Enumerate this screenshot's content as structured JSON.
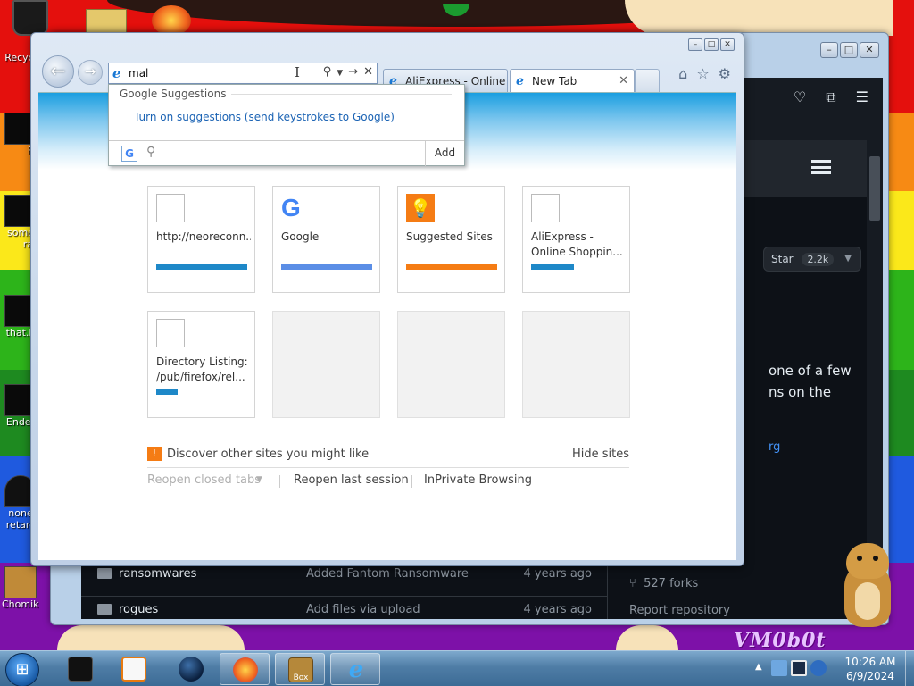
{
  "desktop": {
    "icons": [
      {
        "label": "Recycl"
      },
      {
        "label": "Fir"
      },
      {
        "label": "some"
      },
      {
        "label": "ran"
      },
      {
        "label": "that.b"
      },
      {
        "label": "Ender"
      },
      {
        "label": "none"
      },
      {
        "label": "retarc"
      },
      {
        "label": "ChomikB"
      }
    ],
    "watermark": "VM0b0t"
  },
  "bg_window": {
    "star_label": "Star",
    "star_count": "2.2k",
    "description_line1": "one of a few",
    "description_line2": "ns on the",
    "link_fragment": "rg",
    "files": [
      {
        "name": "ransomwares",
        "message": "Added Fantom Ransomware",
        "time": "4 years ago"
      },
      {
        "name": "rogues",
        "message": "Add files via upload",
        "time": "4 years ago"
      }
    ],
    "forks": "527 forks",
    "report": "Report repository"
  },
  "ie": {
    "address_value": "mal",
    "tabs": [
      {
        "label": "AliExpress - Online ..."
      },
      {
        "label": "New Tab"
      }
    ],
    "suggestions": {
      "heading": "Google Suggestions",
      "link": "Turn on suggestions (send keystrokes to Google)",
      "provider_icon": "G",
      "add_label": "Add"
    },
    "tiles": [
      {
        "label": "http://neoreconn..."
      },
      {
        "label": "Google"
      },
      {
        "label": "Suggested Sites"
      },
      {
        "label": "AliExpress - Online Shoppin..."
      },
      {
        "label": "Directory Listing: /pub/firefox/rel..."
      }
    ],
    "discover_text": "Discover other sites you might like",
    "hide_sites": "Hide sites",
    "reopen_closed": "Reopen closed tabs",
    "reopen_last": "Reopen last session",
    "inprivate": "InPrivate Browsing"
  },
  "taskbar": {
    "time": "10:26 AM",
    "date": "6/9/2024",
    "box_label": "Box"
  },
  "colors": {
    "tile_bar_blue": "#1e88c8",
    "tile_bar_google": "#5b8ee6",
    "tile_bar_orange": "#f57c14"
  }
}
